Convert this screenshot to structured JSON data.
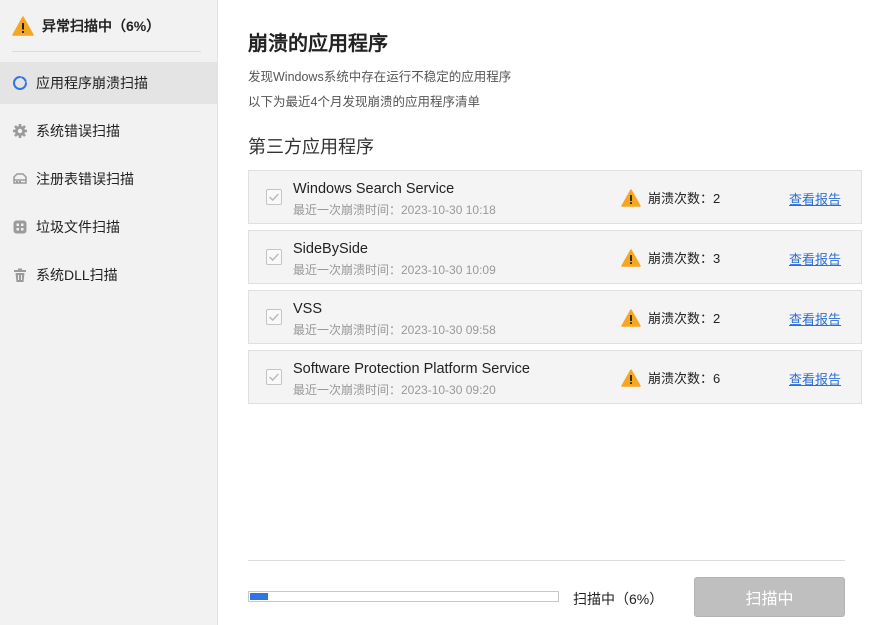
{
  "sidebar": {
    "status": {
      "text": "异常扫描中（6%）",
      "icon": "warning-icon"
    },
    "items": [
      {
        "label": "应用程序崩溃扫描",
        "icon": "loading-icon",
        "active": true
      },
      {
        "label": "系统错误扫描",
        "icon": "gear-icon",
        "active": false
      },
      {
        "label": "注册表错误扫描",
        "icon": "registry-icon",
        "active": false
      },
      {
        "label": "垃圾文件扫描",
        "icon": "apps-icon",
        "active": false
      },
      {
        "label": "系统DLL扫描",
        "icon": "trash-icon",
        "active": false
      }
    ]
  },
  "main": {
    "title": "崩溃的应用程序",
    "desc1": "发现Windows系统中存在运行不稳定的应用程序",
    "desc2": "以下为最近4个月发现崩溃的应用程序清单",
    "section": "第三方应用程序",
    "apps": [
      {
        "name": "Windows Search Service",
        "time": "最近一次崩溃时间：2023-10-30 10:18",
        "crash": "崩溃次数：2",
        "report": "查看报告"
      },
      {
        "name": "SideBySide",
        "time": "最近一次崩溃时间：2023-10-30 10:09",
        "crash": "崩溃次数：3",
        "report": "查看报告"
      },
      {
        "name": "VSS",
        "time": "最近一次崩溃时间：2023-10-30 09:58",
        "crash": "崩溃次数：2",
        "report": "查看报告"
      },
      {
        "name": "Software Protection Platform Service",
        "time": "最近一次崩溃时间：2023-10-30 09:20",
        "crash": "崩溃次数：6",
        "report": "查看报告"
      }
    ]
  },
  "footer": {
    "progress_percent": 6,
    "progress_text": "扫描中（6%）",
    "button": "扫描中"
  },
  "colors": {
    "warning": "#f5a623",
    "accent": "#2f77e0",
    "link": "#2b6fd6"
  }
}
